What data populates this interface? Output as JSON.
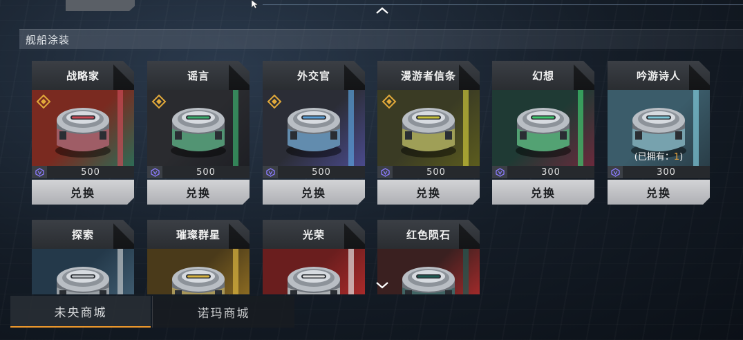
{
  "section": {
    "title": "舰船涂装"
  },
  "colors": {
    "accent_orange": "#f09a2c",
    "tier_gold": "#e2a93a",
    "currency_purple": "#6b5cff"
  },
  "cards": [
    {
      "name": "战略家",
      "price": "500",
      "button": "兑换",
      "tier_badge": true,
      "bg": [
        "#7a2a20",
        "#2e6a55"
      ],
      "accent": "#c84a55"
    },
    {
      "name": "谣言",
      "price": "500",
      "button": "兑换",
      "tier_badge": true,
      "bg": [
        "#2a2b2f",
        "#1e1f24"
      ],
      "accent": "#3cae6e"
    },
    {
      "name": "外交官",
      "price": "500",
      "button": "兑换",
      "tier_badge": true,
      "bg": [
        "#2b2d36",
        "#4a4a8c"
      ],
      "accent": "#5aa0d8"
    },
    {
      "name": "漫游者信条",
      "price": "500",
      "button": "兑换",
      "tier_badge": true,
      "bg": [
        "#3a3b24",
        "#5c5c1e"
      ],
      "accent": "#c8c23a"
    },
    {
      "name": "幻想",
      "price": "300",
      "button": "兑换",
      "tier_badge": false,
      "bg": [
        "#1f3a34",
        "#6a2a3c"
      ],
      "accent": "#3ec86e"
    },
    {
      "name": "吟游诗人",
      "price": "300",
      "button": "兑换",
      "tier_badge": false,
      "owned_prefix": "(已拥有：",
      "owned_count": "1",
      "owned_suffix": ")",
      "bg": [
        "#3b5c6a",
        "#2a3e48"
      ],
      "accent": "#7fc8d8"
    },
    {
      "name": "探索",
      "bg": [
        "#24394a",
        "#3e5a6e"
      ],
      "accent": "#c0c4c8"
    },
    {
      "name": "璀璨群星",
      "bg": [
        "#4a3a1a",
        "#8a6a22"
      ],
      "accent": "#d8b440"
    },
    {
      "name": "光荣",
      "bg": [
        "#6a1e1e",
        "#a82a2a"
      ],
      "accent": "#e0e0e0"
    },
    {
      "name": "红色陨石",
      "bg": [
        "#3a2020",
        "#a02a2a"
      ],
      "accent": "#1e5a52"
    }
  ],
  "bottom_tabs": [
    {
      "label": "未央商城",
      "active": true
    },
    {
      "label": "诺玛商城",
      "active": false
    }
  ],
  "icons": {
    "scroll_up": "chevron-up-icon",
    "scroll_down": "chevron-down-icon",
    "tier": "diamond-tier-icon",
    "currency": "crystal-currency-icon",
    "item": "paint-can-icon"
  }
}
